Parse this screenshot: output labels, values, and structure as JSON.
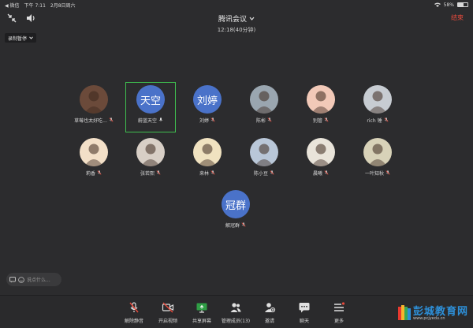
{
  "status_bar": {
    "back_label": "◀ 微信",
    "time": "下午 7:11",
    "date": "2月8日周六",
    "battery": "58%",
    "battery_level": 0.58
  },
  "meeting": {
    "title": "腾讯会议",
    "duration": "12:18(40分钟)",
    "end_label": "结束",
    "recording_label": "录制暂停"
  },
  "participants": [
    {
      "name": "草莓也太好吃...",
      "avatar_text": "",
      "avatar_color": "#6b4a3a",
      "icon": "mic-muted-icon"
    },
    {
      "name": "蔚蓝天空",
      "avatar_text": "天空",
      "avatar_color": "#4a72c9",
      "icon": "mic-icon"
    },
    {
      "name": "刘婷",
      "avatar_text": "刘婷",
      "avatar_color": "#4a72c9",
      "icon": "mic-muted-icon"
    },
    {
      "name": "陈彬",
      "avatar_text": "",
      "avatar_color": "#9aa6b0",
      "icon": "mic-muted-icon"
    },
    {
      "name": "别管",
      "avatar_text": "",
      "avatar_color": "#f2c9b8",
      "icon": "mic-muted-icon"
    },
    {
      "name": "rich 锤",
      "avatar_text": "",
      "avatar_color": "#c7ccd2",
      "icon": "mic-muted-icon"
    },
    {
      "name": "莉香",
      "avatar_text": "",
      "avatar_color": "#f3e0c8",
      "icon": "mic-muted-icon"
    },
    {
      "name": "张若熙",
      "avatar_text": "",
      "avatar_color": "#d8cfc6",
      "icon": "mic-muted-icon"
    },
    {
      "name": "来林",
      "avatar_text": "",
      "avatar_color": "#f0e2c0",
      "icon": "mic-muted-icon"
    },
    {
      "name": "陈小豆",
      "avatar_text": "",
      "avatar_color": "#b9c7d8",
      "icon": "mic-muted-icon"
    },
    {
      "name": "晨曦",
      "avatar_text": "",
      "avatar_color": "#e9e4da",
      "icon": "mic-muted-icon"
    },
    {
      "name": "一叶知秋",
      "avatar_text": "",
      "avatar_color": "#d8d2b8",
      "icon": "mic-muted-icon"
    },
    {
      "name": "解冠群",
      "avatar_text": "冠群",
      "avatar_color": "#4a72c9",
      "icon": "mic-muted-icon"
    }
  ],
  "chat": {
    "placeholder": "说点什么..."
  },
  "toolbar": [
    {
      "label": "解除静音",
      "icon": "mic-muted-icon"
    },
    {
      "label": "开启视频",
      "icon": "video-off-icon"
    },
    {
      "label": "共享屏幕",
      "icon": "share-screen-icon"
    },
    {
      "label": "管理成员(13)",
      "icon": "members-icon"
    },
    {
      "label": "邀请",
      "icon": "invite-icon"
    },
    {
      "label": "聊天",
      "icon": "chat-icon"
    },
    {
      "label": "更多",
      "icon": "more-icon"
    }
  ],
  "watermark": {
    "title": "彭城教育网",
    "url": "www.pcjyedu.cn"
  }
}
